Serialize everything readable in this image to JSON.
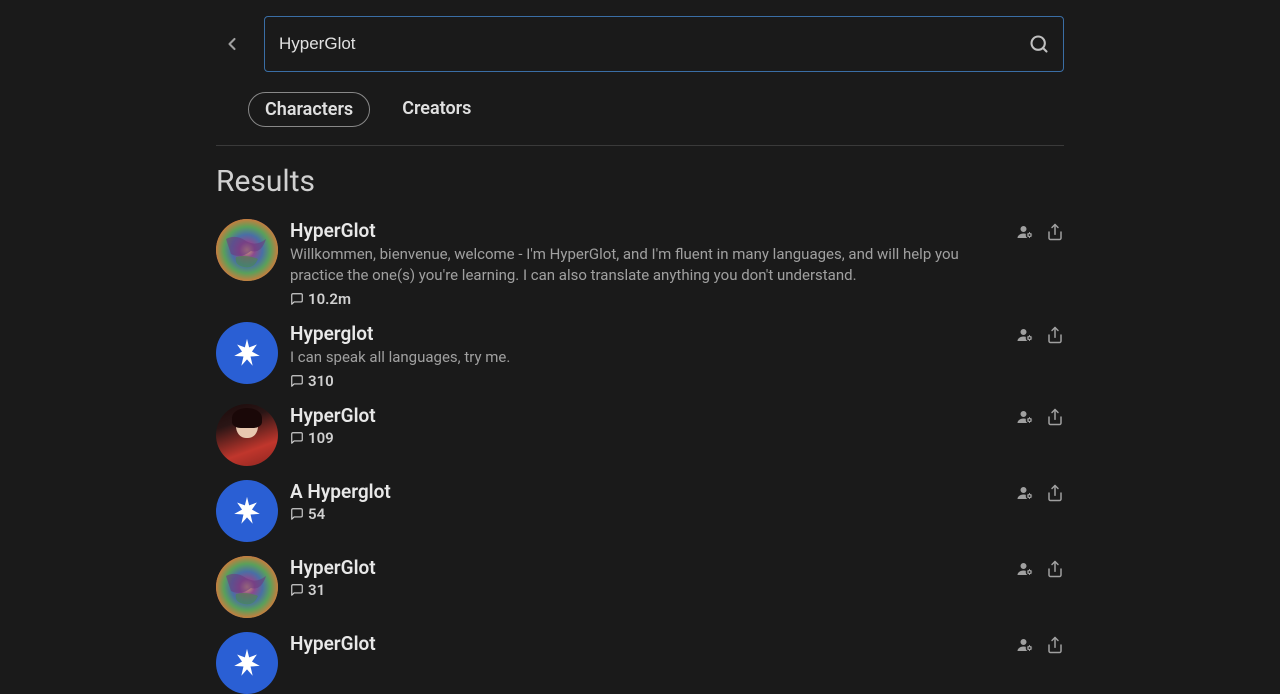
{
  "search": {
    "value": "HyperGlot"
  },
  "tabs": {
    "characters": "Characters",
    "creators": "Creators",
    "active": "characters"
  },
  "resultsTitle": "Results",
  "results": [
    {
      "name": "HyperGlot",
      "description": "Willkommen, bienvenue, welcome - I'm HyperGlot, and I'm fluent in many languages, and will help you practice the one(s) you're learning. I can also translate anything you don't understand.",
      "count": "10.2m",
      "avatarType": "world"
    },
    {
      "name": "Hyperglot",
      "description": "I can speak all languages, try me.",
      "count": "310",
      "avatarType": "star"
    },
    {
      "name": "HyperGlot",
      "description": "",
      "count": "109",
      "avatarType": "person"
    },
    {
      "name": "A Hyperglot",
      "description": "",
      "count": "54",
      "avatarType": "star"
    },
    {
      "name": "HyperGlot",
      "description": "",
      "count": "31",
      "avatarType": "world"
    },
    {
      "name": "HyperGlot",
      "description": "",
      "count": "",
      "avatarType": "star"
    }
  ]
}
